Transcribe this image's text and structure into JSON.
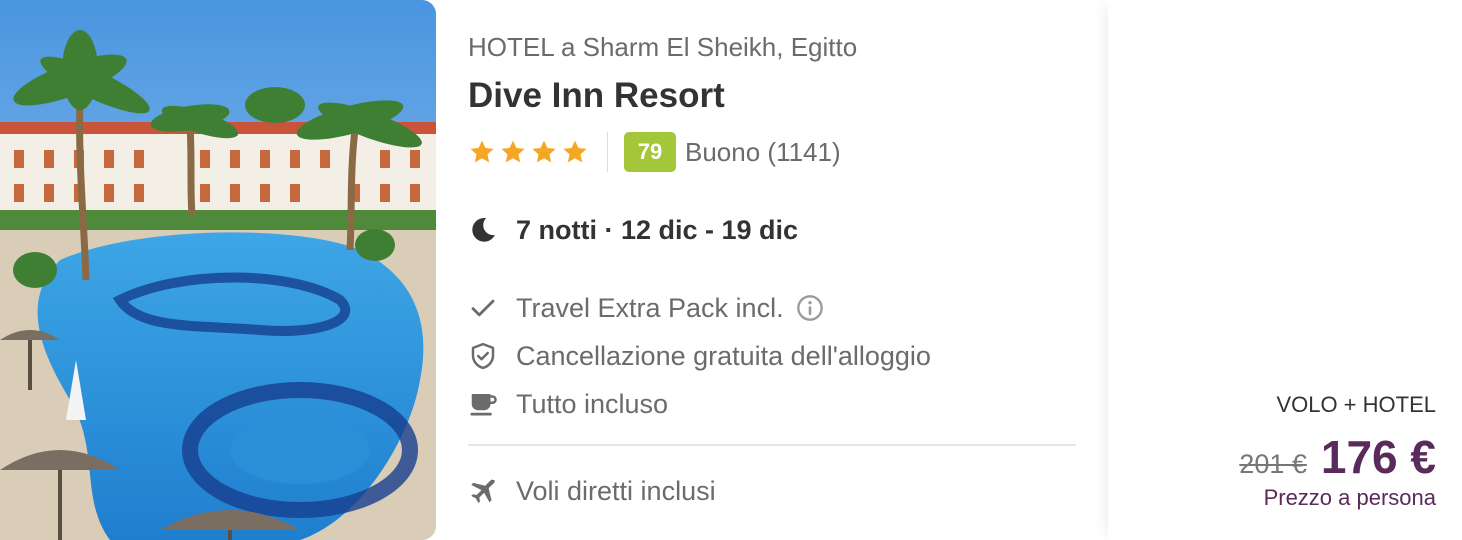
{
  "hotel": {
    "location": "HOTEL a Sharm El Sheikh, Egitto",
    "name": "Dive Inn Resort",
    "stars": 4,
    "score": "79",
    "review_label": "Buono (1141)"
  },
  "stay": {
    "icon": "moon-icon",
    "dates": "7 notti · 12 dic - 19 dic"
  },
  "features": [
    {
      "icon": "check-icon",
      "label": "Travel Extra Pack incl.",
      "info_icon": "info-icon"
    },
    {
      "icon": "shield-check-icon",
      "label": "Cancellazione gratuita dell'alloggio"
    },
    {
      "icon": "coffee-cup-icon",
      "label": "Tutto incluso"
    }
  ],
  "flight": {
    "icon": "airplane-icon",
    "label": "Voli diretti inclusi"
  },
  "price": {
    "type": "VOLO + HOTEL",
    "old": "201 €",
    "current": "176 €",
    "per_person": "Prezzo a persona"
  },
  "colors": {
    "star": "#f5a623",
    "score_badge": "#a4c639",
    "price": "#5a2a5c",
    "muted_text": "#6b6b6b",
    "text": "#333333"
  }
}
